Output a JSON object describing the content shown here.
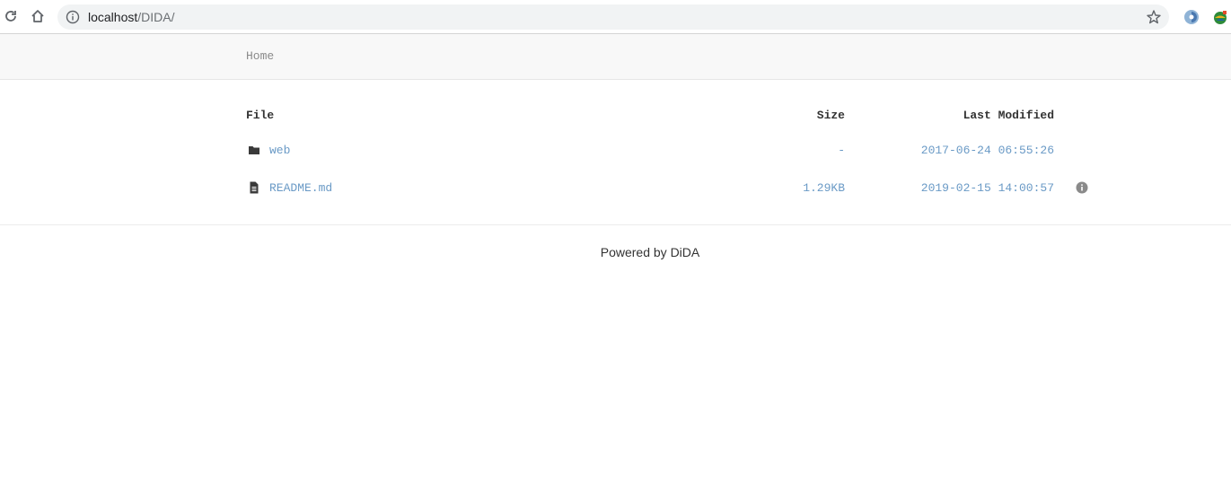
{
  "browser": {
    "url_host": "localhost",
    "url_path": "/DIDA/",
    "icons": {
      "reload": "reload-icon",
      "home": "home-icon",
      "site_info": "info-icon",
      "bookmark": "star-icon"
    }
  },
  "breadcrumb": {
    "home_label": "Home"
  },
  "table": {
    "headers": {
      "file": "File",
      "size": "Size",
      "modified": "Last Modified"
    },
    "rows": [
      {
        "icon": "folder-icon",
        "name": "web",
        "size": "-",
        "modified": "2017-06-24 06:55:26"
      },
      {
        "icon": "file-icon",
        "name": "README.md",
        "size": "1.29KB",
        "modified": "2019-02-15 14:00:57"
      }
    ]
  },
  "footer": {
    "text": "Powered by DiDA"
  },
  "colors": {
    "link": "#6a9ac6",
    "crumb_bg": "#f8f8f8",
    "text": "#333333"
  }
}
